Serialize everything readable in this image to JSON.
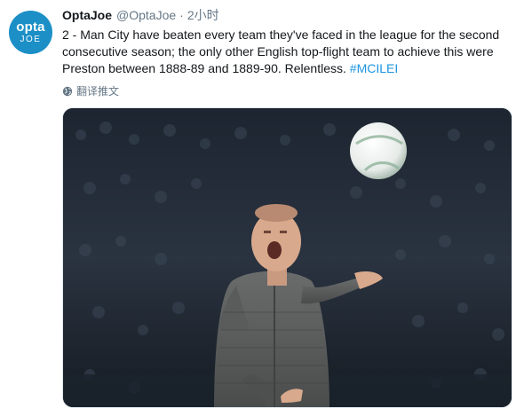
{
  "tweet": {
    "avatar": {
      "line1": "opta",
      "line2": "JOE",
      "color": "#1b8fc6"
    },
    "display_name": "OptaJoe",
    "handle": "@OptaJoe",
    "separator": "·",
    "timestamp": "2小时",
    "text_lines": [
      "2 - Man City have beaten every team they've faced in the league for the second",
      "consecutive season; the only other English top-flight team to achieve this were",
      "Preston between 1888-89 and 1889-90. Relentless. "
    ],
    "hashtag": "#MCILEI",
    "translate_label": "翻译推文",
    "translate_icon": "globe-icon",
    "media": {
      "description_icon": "photo"
    }
  },
  "colors": {
    "text": "#14171a",
    "secondary": "#657786",
    "link": "#1b95e0"
  }
}
